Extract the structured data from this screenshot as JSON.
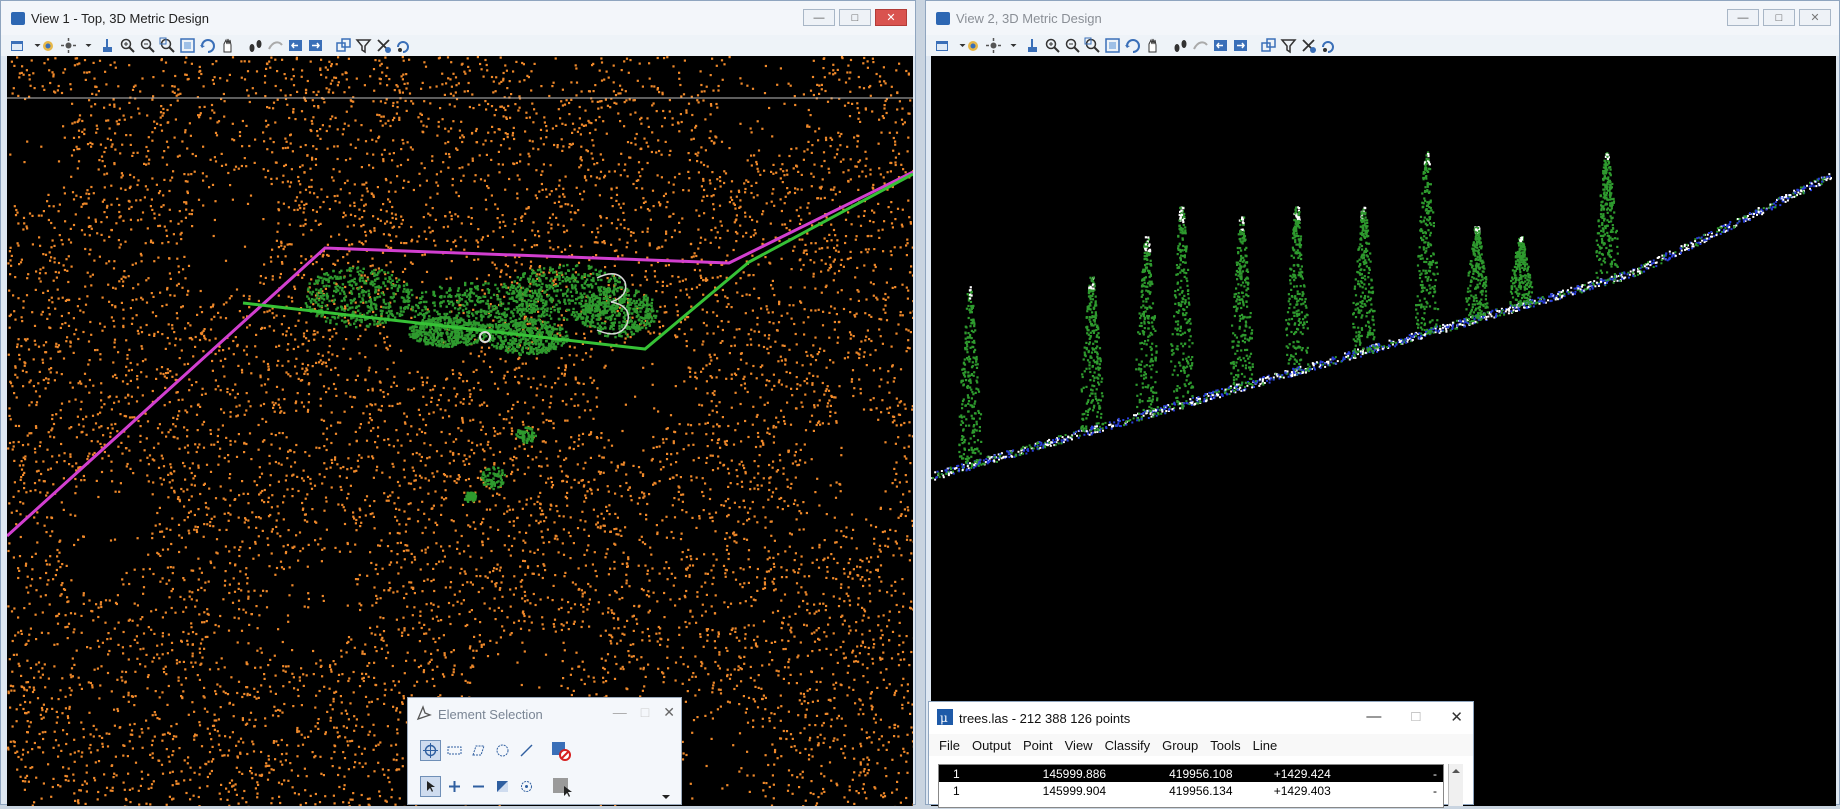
{
  "view1": {
    "title": "View 1 - Top, 3D Metric Design",
    "annotation_number": "3"
  },
  "view2": {
    "title": "View 2, 3D Metric Design"
  },
  "window_buttons": {
    "minimize": "—",
    "maximize": "□",
    "close": "✕"
  },
  "element_selection": {
    "title": "Element Selection"
  },
  "trees_window": {
    "title": "trees.las - 212 388 126 points",
    "menu": [
      "File",
      "Output",
      "Point",
      "View",
      "Classify",
      "Group",
      "Tools",
      "Line"
    ],
    "rows": [
      {
        "c0": "1",
        "c1": "145999.886",
        "c2": "419956.108",
        "c3": "+1429.424",
        "c4": "-"
      },
      {
        "c0": "1",
        "c1": "145999.904",
        "c2": "419956.134",
        "c3": "+1429.403",
        "c4": "-"
      }
    ]
  },
  "colors": {
    "ground_points": "#f0892a",
    "vegetation_points": "#2e9a2e",
    "magenta_line": "#d23fd0",
    "green_line": "#36c236",
    "water_points": "#2a3fd8"
  }
}
